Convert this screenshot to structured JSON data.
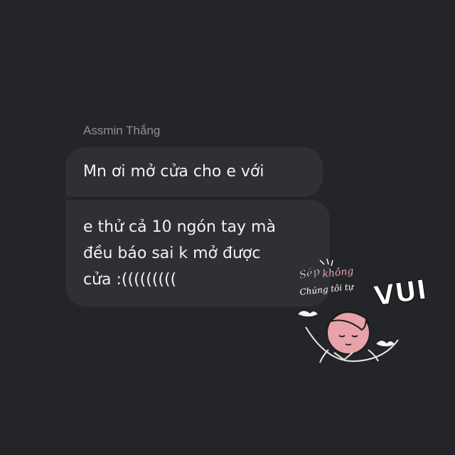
{
  "message": {
    "sender": "Assmin Thắng",
    "bubbles": [
      {
        "lines": [
          "Mn ơi mở cửa cho e với"
        ]
      },
      {
        "lines": [
          "e thử cả 10 ngón tay mà",
          "đều báo sai k mở được",
          "cửa :((((((((("
        ]
      }
    ]
  },
  "watermark": {
    "text_top": "Sếp không",
    "text_middle": "Chúng tôi tự",
    "text_big": "VUI"
  },
  "colors": {
    "background": "#242528",
    "bubble": "#2f3034",
    "text": "#f2f2f2",
    "sender": "#8d8f93",
    "accent_pink": "#e8a2a9"
  }
}
